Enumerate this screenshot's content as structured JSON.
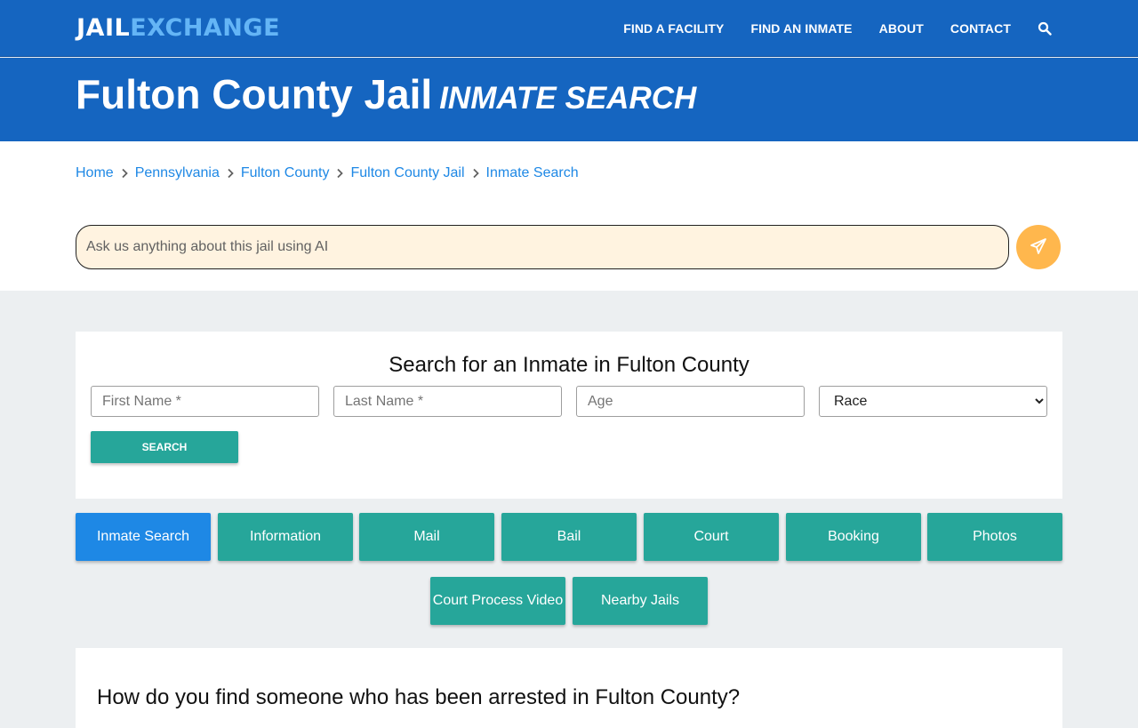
{
  "nav": {
    "logo_part1": "JAIL",
    "logo_part2": "EXCHANGE",
    "links": [
      "FIND A FACILITY",
      "FIND AN INMATE",
      "ABOUT",
      "CONTACT"
    ],
    "search_icon": "search-icon"
  },
  "hero": {
    "title": "Fulton County Jail",
    "subtitle": "INMATE SEARCH"
  },
  "breadcrumb": [
    "Home",
    "Pennsylvania",
    "Fulton County",
    "Fulton County Jail",
    "Inmate Search"
  ],
  "ai": {
    "placeholder": "Ask us anything about this jail using AI",
    "send_icon": "paper-plane-icon"
  },
  "search_form": {
    "title": "Search for an Inmate in Fulton County",
    "first_name_placeholder": "First Name *",
    "last_name_placeholder": "Last Name *",
    "age_placeholder": "Age",
    "race_selected": "Race",
    "button_label": "SEARCH"
  },
  "tabs": {
    "row1": [
      "Inmate Search",
      "Information",
      "Mail",
      "Bail",
      "Court",
      "Booking",
      "Photos"
    ],
    "row2": [
      "Court Process Video",
      "Nearby Jails"
    ],
    "active": "Inmate Search"
  },
  "article": {
    "heading": "How do you find someone who has been arrested in Fulton County?"
  },
  "colors": {
    "primary": "#1565c0",
    "logo_accent": "#64b5f6",
    "teal": "#26a69a",
    "active_tab": "#1e88e5",
    "ai_input_bg": "#fff3e0",
    "ai_button": "#ffb74d",
    "page_bg": "#eceff1"
  }
}
